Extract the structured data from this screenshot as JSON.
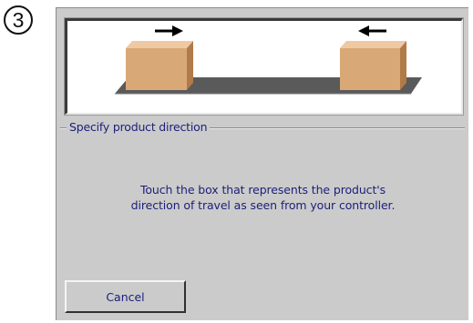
{
  "step": {
    "number": "3"
  },
  "diagram": {
    "icons": {
      "left_box": "box-moving-right",
      "right_box": "box-moving-left",
      "left_arrow": "arrow-right-icon",
      "right_arrow": "arrow-left-icon"
    },
    "colors": {
      "box_front": "#d9a877",
      "box_side": "#b07a49",
      "box_top": "#efc9a2",
      "conveyor": "#5a5a5a",
      "arrow": "#000000"
    }
  },
  "group": {
    "title": "Specify product direction"
  },
  "instructions": {
    "line1": "Touch the box that represents the product's",
    "line2": "direction of travel as seen from your controller."
  },
  "buttons": {
    "cancel_label": "Cancel"
  },
  "colors": {
    "panel_bg": "#cbcbcb",
    "text": "#1b1f7a"
  }
}
